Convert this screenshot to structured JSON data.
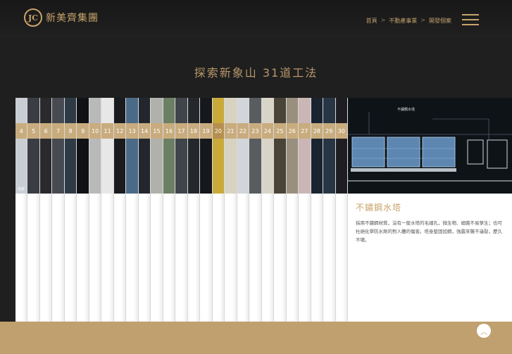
{
  "brand": {
    "name": "新美齊集團",
    "mark": "JC"
  },
  "breadcrumb": [
    {
      "label": "首頁"
    },
    {
      "label": "不動產事業"
    },
    {
      "label": "開發個案"
    }
  ],
  "breadcrumb_separator": ">",
  "menu": {
    "icon": "hamburger-menu-icon"
  },
  "page": {
    "title": "探索新象山  31道工法"
  },
  "strips": [
    {
      "number": "4",
      "label": "他潔",
      "photo": "#c9ced3"
    },
    {
      "number": "5",
      "label": "",
      "photo": "#3a3e44"
    },
    {
      "number": "6",
      "label": "",
      "photo": "#2a2a2c"
    },
    {
      "number": "7",
      "label": "",
      "photo": "#474b51"
    },
    {
      "number": "8",
      "label": "",
      "photo": "#2f3a47"
    },
    {
      "number": "9",
      "label": "",
      "photo": "#101216"
    },
    {
      "number": "10",
      "label": "",
      "photo": "#b9b9b9"
    },
    {
      "number": "11",
      "label": "",
      "photo": "#e7e7e7"
    },
    {
      "number": "12",
      "label": "",
      "photo": "#1a1b1f"
    },
    {
      "number": "13",
      "label": "",
      "photo": "#4b6a88"
    },
    {
      "number": "14",
      "label": "",
      "photo": "#23272d"
    },
    {
      "number": "15",
      "label": "",
      "photo": "#b1b1ac"
    },
    {
      "number": "16",
      "label": "",
      "photo": "#6b7f62"
    },
    {
      "number": "17",
      "label": "",
      "photo": "#3f454a"
    },
    {
      "number": "18",
      "label": "",
      "photo": "#24282c"
    },
    {
      "number": "19",
      "label": "",
      "photo": "#16181b"
    },
    {
      "number": "20",
      "label": "",
      "photo": "#c9a93a"
    },
    {
      "number": "21",
      "label": "",
      "photo": "#d8d2c0"
    },
    {
      "number": "22",
      "label": "",
      "photo": "#d2d6da"
    },
    {
      "number": "23",
      "label": "",
      "photo": "#595d60"
    },
    {
      "number": "24",
      "label": "",
      "photo": "#d9d4c8"
    },
    {
      "number": "25",
      "label": "",
      "photo": "#4a4438"
    },
    {
      "number": "26",
      "label": "",
      "photo": "#9a8f7f"
    },
    {
      "number": "27",
      "label": "",
      "photo": "#cbb6b6"
    },
    {
      "number": "28",
      "label": "",
      "photo": "#1a2430"
    },
    {
      "number": "29",
      "label": "",
      "photo": "#283544"
    },
    {
      "number": "30",
      "label": "",
      "photo": "#1e1e22"
    }
  ],
  "feature": {
    "title": "不鏽鋼水塔",
    "image_label": "不鏽鋼水塔",
    "description": "採用不鏽鋼材質，沒有一般水塔的毛細孔，微生物、細菌不易孳生；也可杜絕化學防水劑的對人體的傷害。塔身堅固如鋼，強震來襲不龜裂，歷久不壞。"
  },
  "colors": {
    "accent": "#c8a46a",
    "footer": "#c0a06e",
    "strip_number": "#c9ac7e"
  },
  "scroll_top": {
    "icon": "chevron-up-icon",
    "glyph": "︿"
  }
}
